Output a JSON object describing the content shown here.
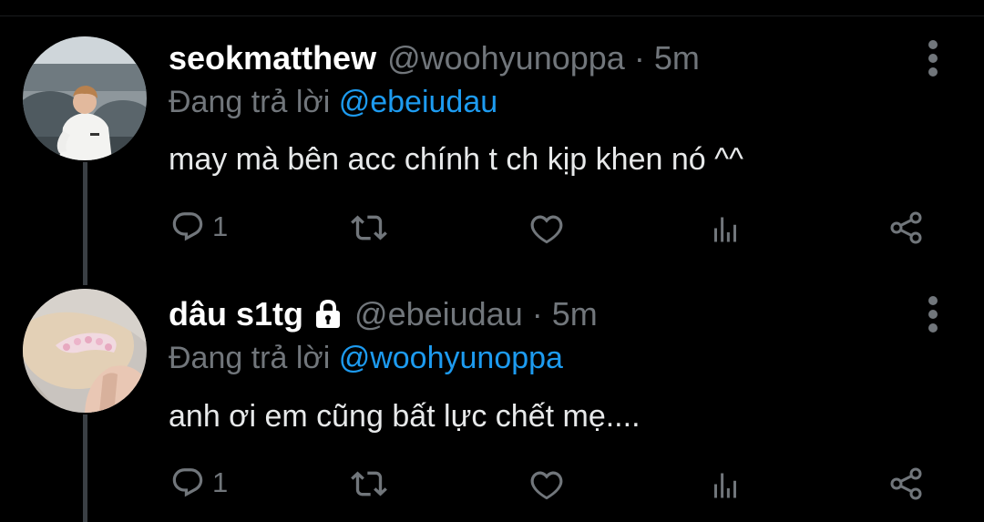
{
  "tweets": [
    {
      "display_name": "seokmatthew",
      "handle": "@woohyunoppa",
      "separator": " · ",
      "time": "5m",
      "locked": false,
      "replying_prefix": "Đang trả lời ",
      "replying_to": "@ebeiudau",
      "text": "may mà bên acc chính t ch kịp khen nó ^^",
      "reply_count": "1",
      "retweet_count": "",
      "like_count": ""
    },
    {
      "display_name": "dâu s1tg",
      "handle": "@ebeiudau",
      "separator": " · ",
      "time": "5m",
      "locked": true,
      "replying_prefix": "Đang trả lời ",
      "replying_to": "@woohyunoppa",
      "text": "anh ơi em cũng bất lực chết mẹ....",
      "reply_count": "1",
      "retweet_count": "",
      "like_count": ""
    }
  ],
  "icons": {
    "reply": "reply-bubble-icon",
    "retweet": "retweet-icon",
    "like": "heart-icon",
    "views": "analytics-bars-icon",
    "share": "share-icon",
    "more": "more-vertical-icon",
    "lock": "lock-icon"
  },
  "colors": {
    "background": "#000000",
    "text": "#e7e9ea",
    "secondary": "#71767b",
    "accent": "#1d9bf0",
    "thread_line": "#3a3f44"
  }
}
